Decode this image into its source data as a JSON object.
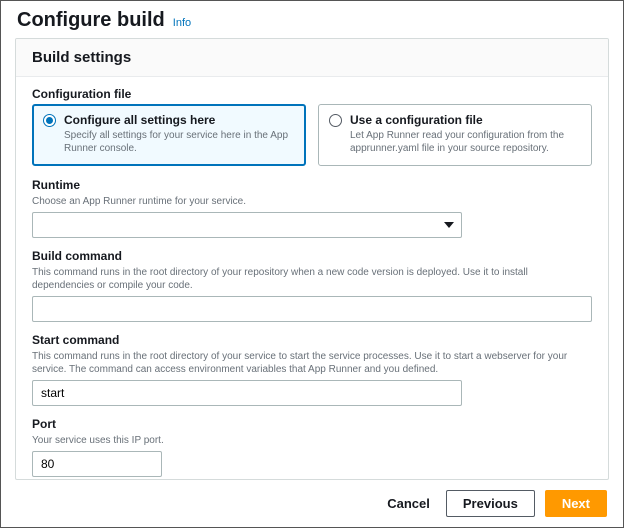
{
  "header": {
    "title": "Configure build",
    "info_link": "Info"
  },
  "panel": {
    "title": "Build settings"
  },
  "config_file": {
    "label": "Configuration file",
    "options": [
      {
        "title": "Configure all settings here",
        "desc": "Specify all settings for your service here in the App Runner console.",
        "selected": true
      },
      {
        "title": "Use a configuration file",
        "desc": "Let App Runner read your configuration from the apprunner.yaml file in your source repository.",
        "selected": false
      }
    ]
  },
  "runtime": {
    "label": "Runtime",
    "desc": "Choose an App Runner runtime for your service.",
    "value": ""
  },
  "build_command": {
    "label": "Build command",
    "desc": "This command runs in the root directory of your repository when a new code version is deployed. Use it to install dependencies or compile your code.",
    "value": ""
  },
  "start_command": {
    "label": "Start command",
    "desc": "This command runs in the root directory of your service to start the service processes. Use it to start a webserver for your service. The command can access environment variables that App Runner and you defined.",
    "value": "start"
  },
  "port": {
    "label": "Port",
    "desc": "Your service uses this IP port.",
    "value": "80"
  },
  "footer": {
    "cancel": "Cancel",
    "previous": "Previous",
    "next": "Next"
  }
}
